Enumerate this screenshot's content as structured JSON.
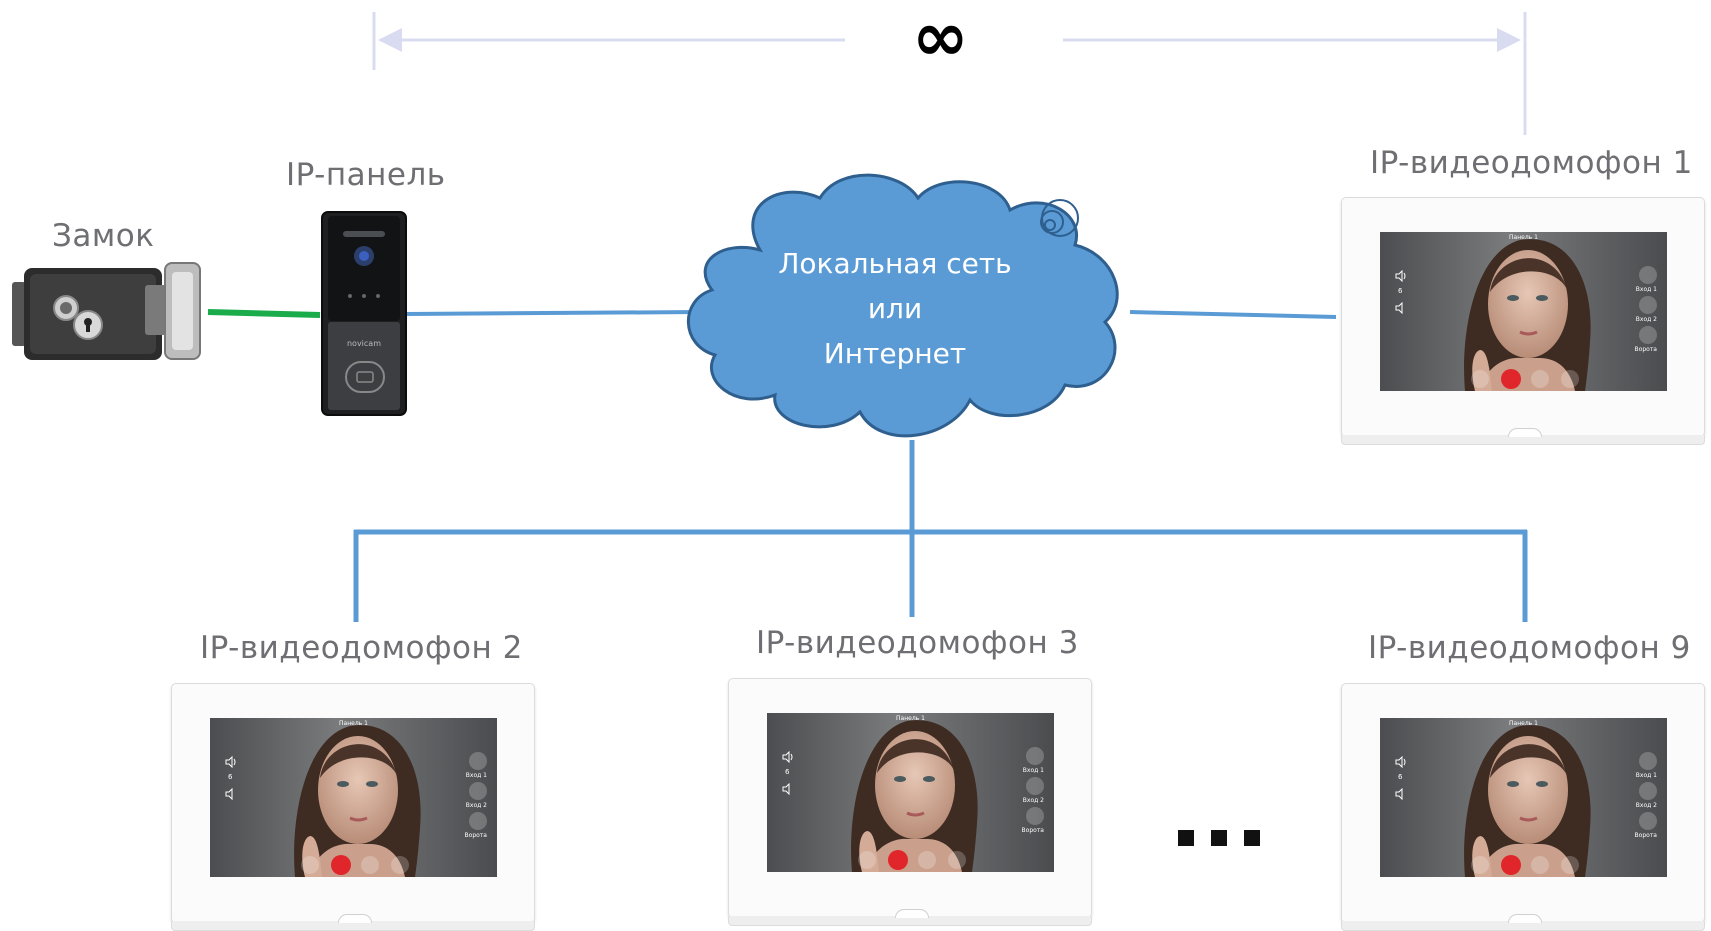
{
  "infinity_symbol": "∞",
  "labels": {
    "lock": "Замок",
    "panel": "IP-панель",
    "monitor1": "IP-видеодомофон 1",
    "monitor2": "IP-видеодомофон 2",
    "monitor3": "IP-видеодомофон 3",
    "monitor9": "IP-видеодомофон 9"
  },
  "cloud": {
    "line1": "Локальная сеть",
    "line2": "или",
    "line3": "Интернет"
  },
  "panel_brand": "novicam",
  "monitor_screen": {
    "title": "Панель 1",
    "volume": "6",
    "entry1": "Вход 1",
    "entry2": "Вход 2",
    "gate": "Ворота"
  },
  "colors": {
    "network_line": "#5b9bd5",
    "lock_line": "#1aac4a",
    "cloud_fill": "#5b9bd5",
    "arrow_line": "#d9dcf0",
    "end_call": "#e0262b"
  }
}
